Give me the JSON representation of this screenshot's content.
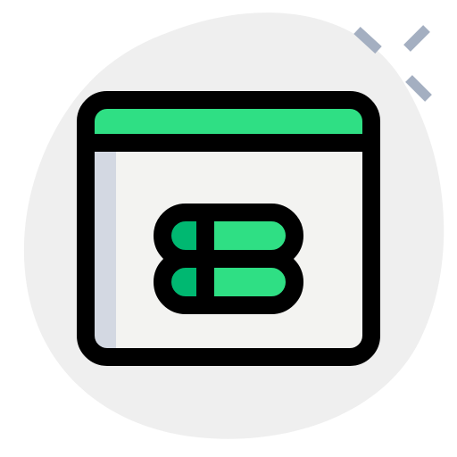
{
  "icon": {
    "name": "browser-database-icon",
    "colors": {
      "blob": "#efefef",
      "sparkle": "#a4afc1",
      "window_body": "#f3f3f1",
      "window_shadow": "#d3d8e2",
      "titlebar": "#2fdf84",
      "capsule_light": "#2fdf84",
      "capsule_dark": "#00b871",
      "outline": "#000000"
    }
  }
}
